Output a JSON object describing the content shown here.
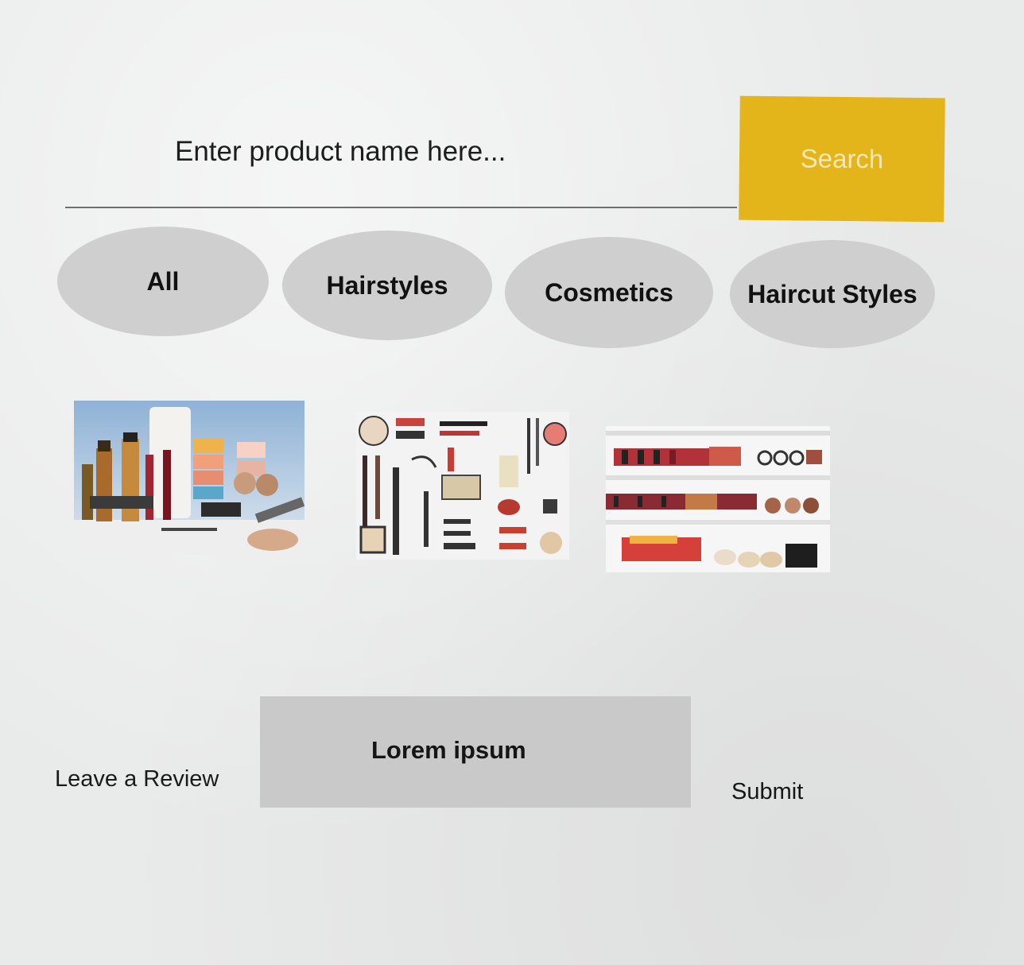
{
  "search": {
    "placeholder": "Enter product name here...",
    "button_label": "Search"
  },
  "categories": [
    {
      "label": "All"
    },
    {
      "label": "Hairstyles"
    },
    {
      "label": "Cosmetics"
    },
    {
      "label": "Haircut Styles"
    }
  ],
  "products": [
    {
      "image": "cosmetics-bottles-photo"
    },
    {
      "image": "makeup-flatlay-photo"
    },
    {
      "image": "cosmetics-store-shelves-photo"
    }
  ],
  "review": {
    "label": "Leave a Review",
    "text": "Lorem ipsum",
    "submit_label": "Submit"
  },
  "colors": {
    "background": "#e9eaea",
    "search_button": "#e3b51a",
    "search_button_text": "#f6e7b4",
    "pill": "#cfcfcf",
    "review_box": "#c9c9c9"
  }
}
